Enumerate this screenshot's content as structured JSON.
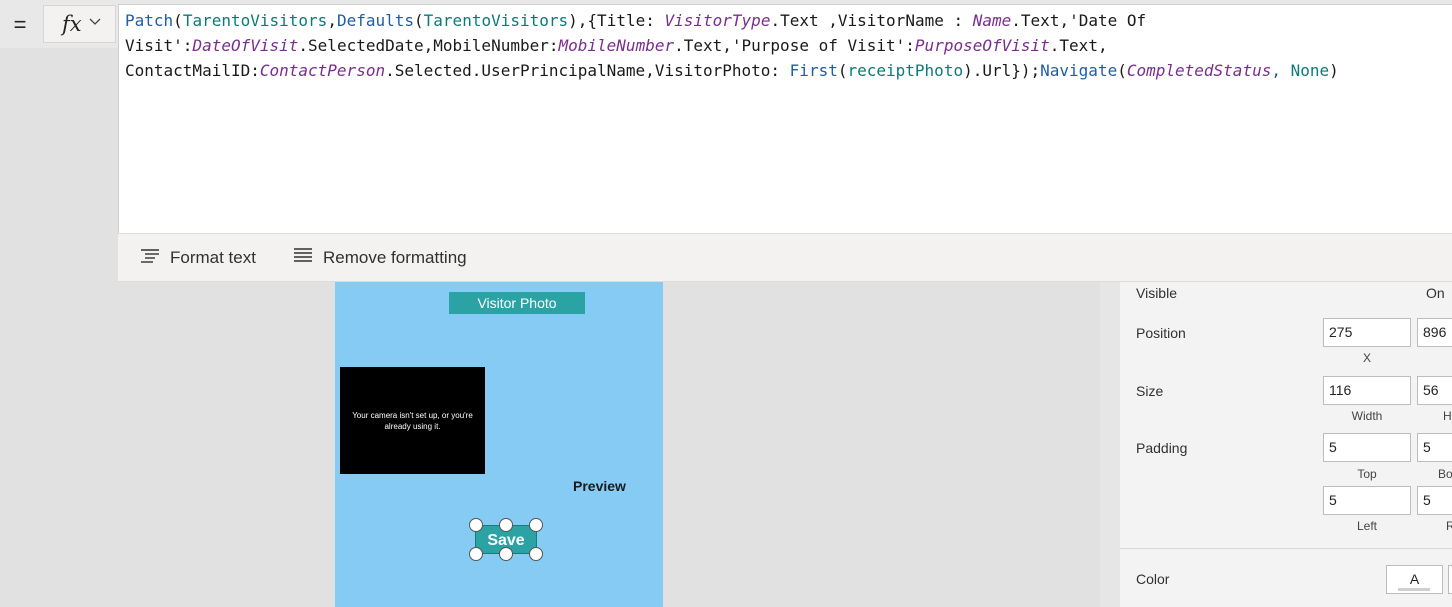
{
  "formula_bar": {
    "equals": "=",
    "fx_label": "fx",
    "code_tokens": [
      [
        {
          "t": "Patch",
          "c": "fn"
        },
        {
          "t": "(",
          "c": "pn"
        },
        {
          "t": "TarentoVisitors",
          "c": "ds"
        },
        {
          "t": ",",
          "c": "pn"
        },
        {
          "t": "Defaults",
          "c": "fn"
        },
        {
          "t": "(",
          "c": "pn"
        },
        {
          "t": "TarentoVisitors",
          "c": "ds"
        },
        {
          "t": "),{Title: ",
          "c": "pn"
        },
        {
          "t": "VisitorType",
          "c": "ctl"
        },
        {
          "t": ".Text ,VisitorName : ",
          "c": "pn"
        },
        {
          "t": "Name",
          "c": "ctl"
        },
        {
          "t": ".Text,'Date Of",
          "c": "pn"
        }
      ],
      [
        {
          "t": "Visit':",
          "c": "pn"
        },
        {
          "t": "DateOfVisit",
          "c": "ctl"
        },
        {
          "t": ".SelectedDate,MobileNumber:",
          "c": "pn"
        },
        {
          "t": "MobileNumber",
          "c": "ctl"
        },
        {
          "t": ".Text,'Purpose of Visit':",
          "c": "pn"
        },
        {
          "t": "PurposeOfVisit",
          "c": "ctl"
        },
        {
          "t": ".Text,",
          "c": "pn"
        }
      ],
      [
        {
          "t": "ContactMailID:",
          "c": "pn"
        },
        {
          "t": "ContactPerson",
          "c": "ctl"
        },
        {
          "t": ".Selected.UserPrincipalName,VisitorPhoto: ",
          "c": "pn"
        },
        {
          "t": "First",
          "c": "fn"
        },
        {
          "t": "(",
          "c": "pn"
        },
        {
          "t": "receiptPhoto",
          "c": "ds"
        },
        {
          "t": ").Url});",
          "c": "pn"
        },
        {
          "t": "Navigate",
          "c": "fn"
        },
        {
          "t": "(",
          "c": "pn"
        },
        {
          "t": "CompletedStatus",
          "c": "ctl"
        },
        {
          "t": ", ",
          "c": "fn"
        },
        {
          "t": "None",
          "c": "ds"
        },
        {
          "t": ")",
          "c": "pn"
        }
      ]
    ]
  },
  "format_toolbar": {
    "format_text": "Format text",
    "remove_formatting": "Remove formatting"
  },
  "canvas": {
    "visitor_photo_label": "Visitor Photo",
    "camera_message": "Your camera isn't set up, or you're already using it.",
    "preview_label": "Preview",
    "save_button": "Save"
  },
  "properties": {
    "visible_label": "Visible",
    "visible_value": "On",
    "position_label": "Position",
    "position_x": "275",
    "position_y": "896",
    "x_label": "X",
    "size_label": "Size",
    "width_value": "116",
    "height_value": "56",
    "width_label": "Width",
    "height_label_partial": "H",
    "padding_label": "Padding",
    "padding_top": "5",
    "padding_bottom": "5",
    "padding_left": "5",
    "padding_right": "5",
    "top_label": "Top",
    "bottom_label_partial": "Bo",
    "left_label": "Left",
    "right_label_partial": "R",
    "color_label": "Color",
    "color_swatch_text": "A"
  },
  "colors": {
    "screen_bg": "#86cbf3",
    "teal": "#2ba3a5",
    "function_blue": "#1f5da8",
    "control_purple": "#7a2d8f",
    "datasource_teal": "#0e7a78"
  },
  "icons": [
    "fx-chevron-down-icon",
    "format-text-icon",
    "remove-formatting-icon"
  ]
}
